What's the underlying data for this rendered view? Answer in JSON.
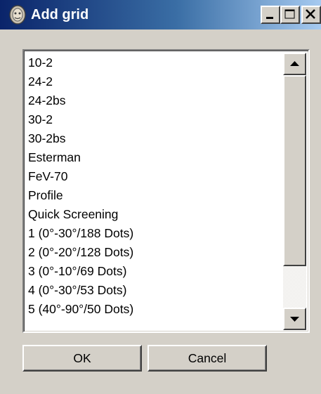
{
  "window": {
    "title": "Add grid",
    "icon": "gear-face-icon",
    "controls": {
      "minimize": "minimize-icon",
      "maximize": "maximize-icon",
      "close": "close-icon"
    }
  },
  "grid_list": {
    "items": [
      "10-2",
      "24-2",
      "24-2bs",
      "30-2",
      "30-2bs",
      "Esterman",
      "FeV-70",
      "Profile",
      "Quick Screening",
      "1 (0°-30°/188 Dots)",
      "2 (0°-20°/128 Dots)",
      "3 (0°-10°/69 Dots)",
      "4 (0°-30°/53 Dots)",
      "5 (40°-90°/50 Dots)"
    ],
    "scroll_position": 0.0
  },
  "buttons": {
    "ok_label": "OK",
    "cancel_label": "Cancel"
  },
  "colors": {
    "title_start": "#0a246a",
    "title_end": "#a6caf0",
    "face": "#d4d0c8"
  }
}
